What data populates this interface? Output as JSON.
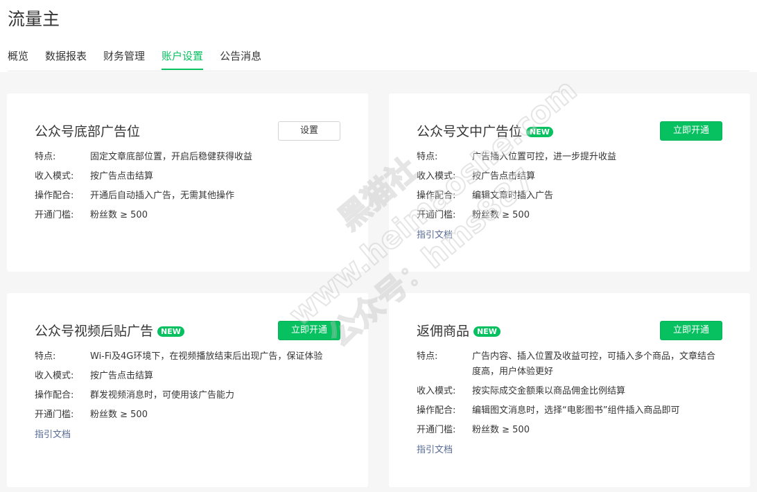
{
  "header": {
    "title": "流量主",
    "tabs": [
      {
        "label": "概览"
      },
      {
        "label": "数据报表"
      },
      {
        "label": "财务管理"
      },
      {
        "label": "账户设置"
      },
      {
        "label": "公告消息"
      }
    ],
    "active_tab": "账户设置"
  },
  "cards": [
    {
      "title": "公众号底部广告位",
      "badge": "",
      "button": "设置",
      "rows": [
        {
          "label": "特点:",
          "value": "固定文章底部位置，开启后稳健获得收益"
        },
        {
          "label": "收入模式:",
          "value": "按广告点击结算"
        },
        {
          "label": "操作配合:",
          "value": "开通后自动插入广告，无需其他操作"
        },
        {
          "label": "开通门槛:",
          "value": "粉丝数 ≥ 500"
        }
      ],
      "link": ""
    },
    {
      "title": "公众号文中广告位",
      "badge": "NEW",
      "button": "立即开通",
      "rows": [
        {
          "label": "特点:",
          "value": "广告插入位置可控，进一步提升收益"
        },
        {
          "label": "收入模式:",
          "value": "按广告点击结算"
        },
        {
          "label": "操作配合:",
          "value": "编辑文章时插入广告"
        },
        {
          "label": "开通门槛:",
          "value": "粉丝数 ≥ 500"
        }
      ],
      "link": "指引文档"
    },
    {
      "title": "公众号视频后贴广告",
      "badge": "NEW",
      "button": "立即开通",
      "rows": [
        {
          "label": "特点:",
          "value": "Wi-Fi及4G环境下，在视频播放结束后出现广告，保证体验"
        },
        {
          "label": "收入模式:",
          "value": "按广告点击结算"
        },
        {
          "label": "操作配合:",
          "value": "群发视频消息时，可使用该广告能力"
        },
        {
          "label": "开通门槛:",
          "value": "粉丝数 ≥ 500"
        }
      ],
      "link": "指引文档"
    },
    {
      "title": "返佣商品",
      "badge": "NEW",
      "button": "立即开通",
      "rows": [
        {
          "label": "特点:",
          "value": "广告内容、插入位置及收益可控，可插入多个商品，文章结合度高，用户体验更好"
        },
        {
          "label": "收入模式:",
          "value": "按实际成交金额乘以商品佣金比例结算"
        },
        {
          "label": "操作配合:",
          "value": "编辑图文消息时，选择“电影图书”组件插入商品即可"
        },
        {
          "label": "开通门槛:",
          "value": "粉丝数 ≥ 500"
        }
      ],
      "link": "指引文档"
    }
  ],
  "watermark": {
    "lines": [
      "黑猫社",
      "www.heimaoshe.com",
      "公众号：hms887"
    ]
  },
  "colors": {
    "accent": "#07c160",
    "link": "#576b95",
    "background": "#f6f6f6"
  }
}
